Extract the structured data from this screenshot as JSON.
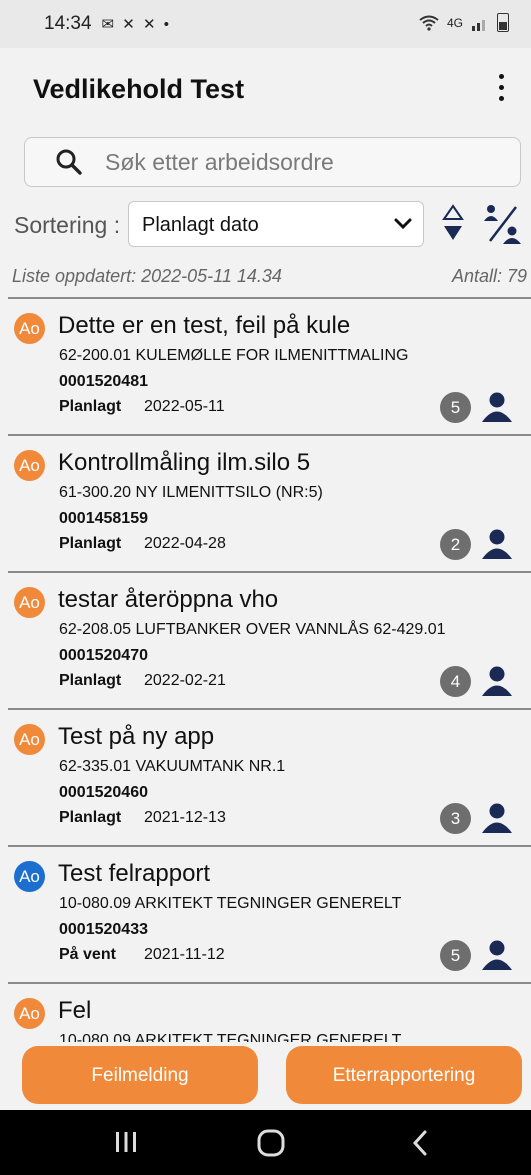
{
  "status_bar": {
    "time": "14:34",
    "notification_icons": "✉ ✕ ✕ •",
    "network": "4G"
  },
  "app": {
    "title": "Vedlikehold Test",
    "menu_icon": "more-vert-icon"
  },
  "search": {
    "placeholder": "Søk etter arbeidsordre"
  },
  "sort": {
    "label": "Sortering :",
    "selected": "Planlagt dato"
  },
  "list_meta": {
    "updated": "Liste oppdatert: 2022-05-11 14.34",
    "count": "Antall: 79"
  },
  "colors": {
    "orange": "#f08a3a",
    "blue": "#1c6fcf",
    "count_grey": "#6e6e6e",
    "person_navy": "#1b2a55"
  },
  "work_orders": [
    {
      "badge": "Ao",
      "badge_color": "orange",
      "title": "Dette er en test, feil på kule",
      "equipment": "62-200.01 KULEMØLLE FOR ILMENITTMALING",
      "number": "0001520481",
      "status": "Planlagt",
      "date": "2022-05-11",
      "count": "5"
    },
    {
      "badge": "Ao",
      "badge_color": "orange",
      "title": "Kontrollmåling ilm.silo 5",
      "equipment": "61-300.20 NY ILMENITTSILO (NR:5)",
      "number": "0001458159",
      "status": "Planlagt",
      "date": "2022-04-28",
      "count": "2"
    },
    {
      "badge": "Ao",
      "badge_color": "orange",
      "title": "testar återöppna vho",
      "equipment": "62-208.05 LUFTBANKER OVER VANNLÅS 62-429.01",
      "number": "0001520470",
      "status": "Planlagt",
      "date": "2022-02-21",
      "count": "4"
    },
    {
      "badge": "Ao",
      "badge_color": "orange",
      "title": "Test på ny app",
      "equipment": "62-335.01 VAKUUMTANK NR.1",
      "number": "0001520460",
      "status": "Planlagt",
      "date": "2021-12-13",
      "count": "3"
    },
    {
      "badge": "Ao",
      "badge_color": "blue",
      "title": "Test felrapport",
      "equipment": "10-080.09 ARKITEKT TEGNINGER GENERELT",
      "number": "0001520433",
      "status": "På vent",
      "date": "2021-11-12",
      "count": "5"
    },
    {
      "badge": "Ao",
      "badge_color": "orange",
      "title": "Fel",
      "equipment": "10-080.09 ARKITEKT TEGNINGER GENERELT",
      "number": "",
      "status": "",
      "date": "",
      "count": ""
    }
  ],
  "buttons": {
    "left": "Feilmelding",
    "right": "Etterrapportering"
  }
}
